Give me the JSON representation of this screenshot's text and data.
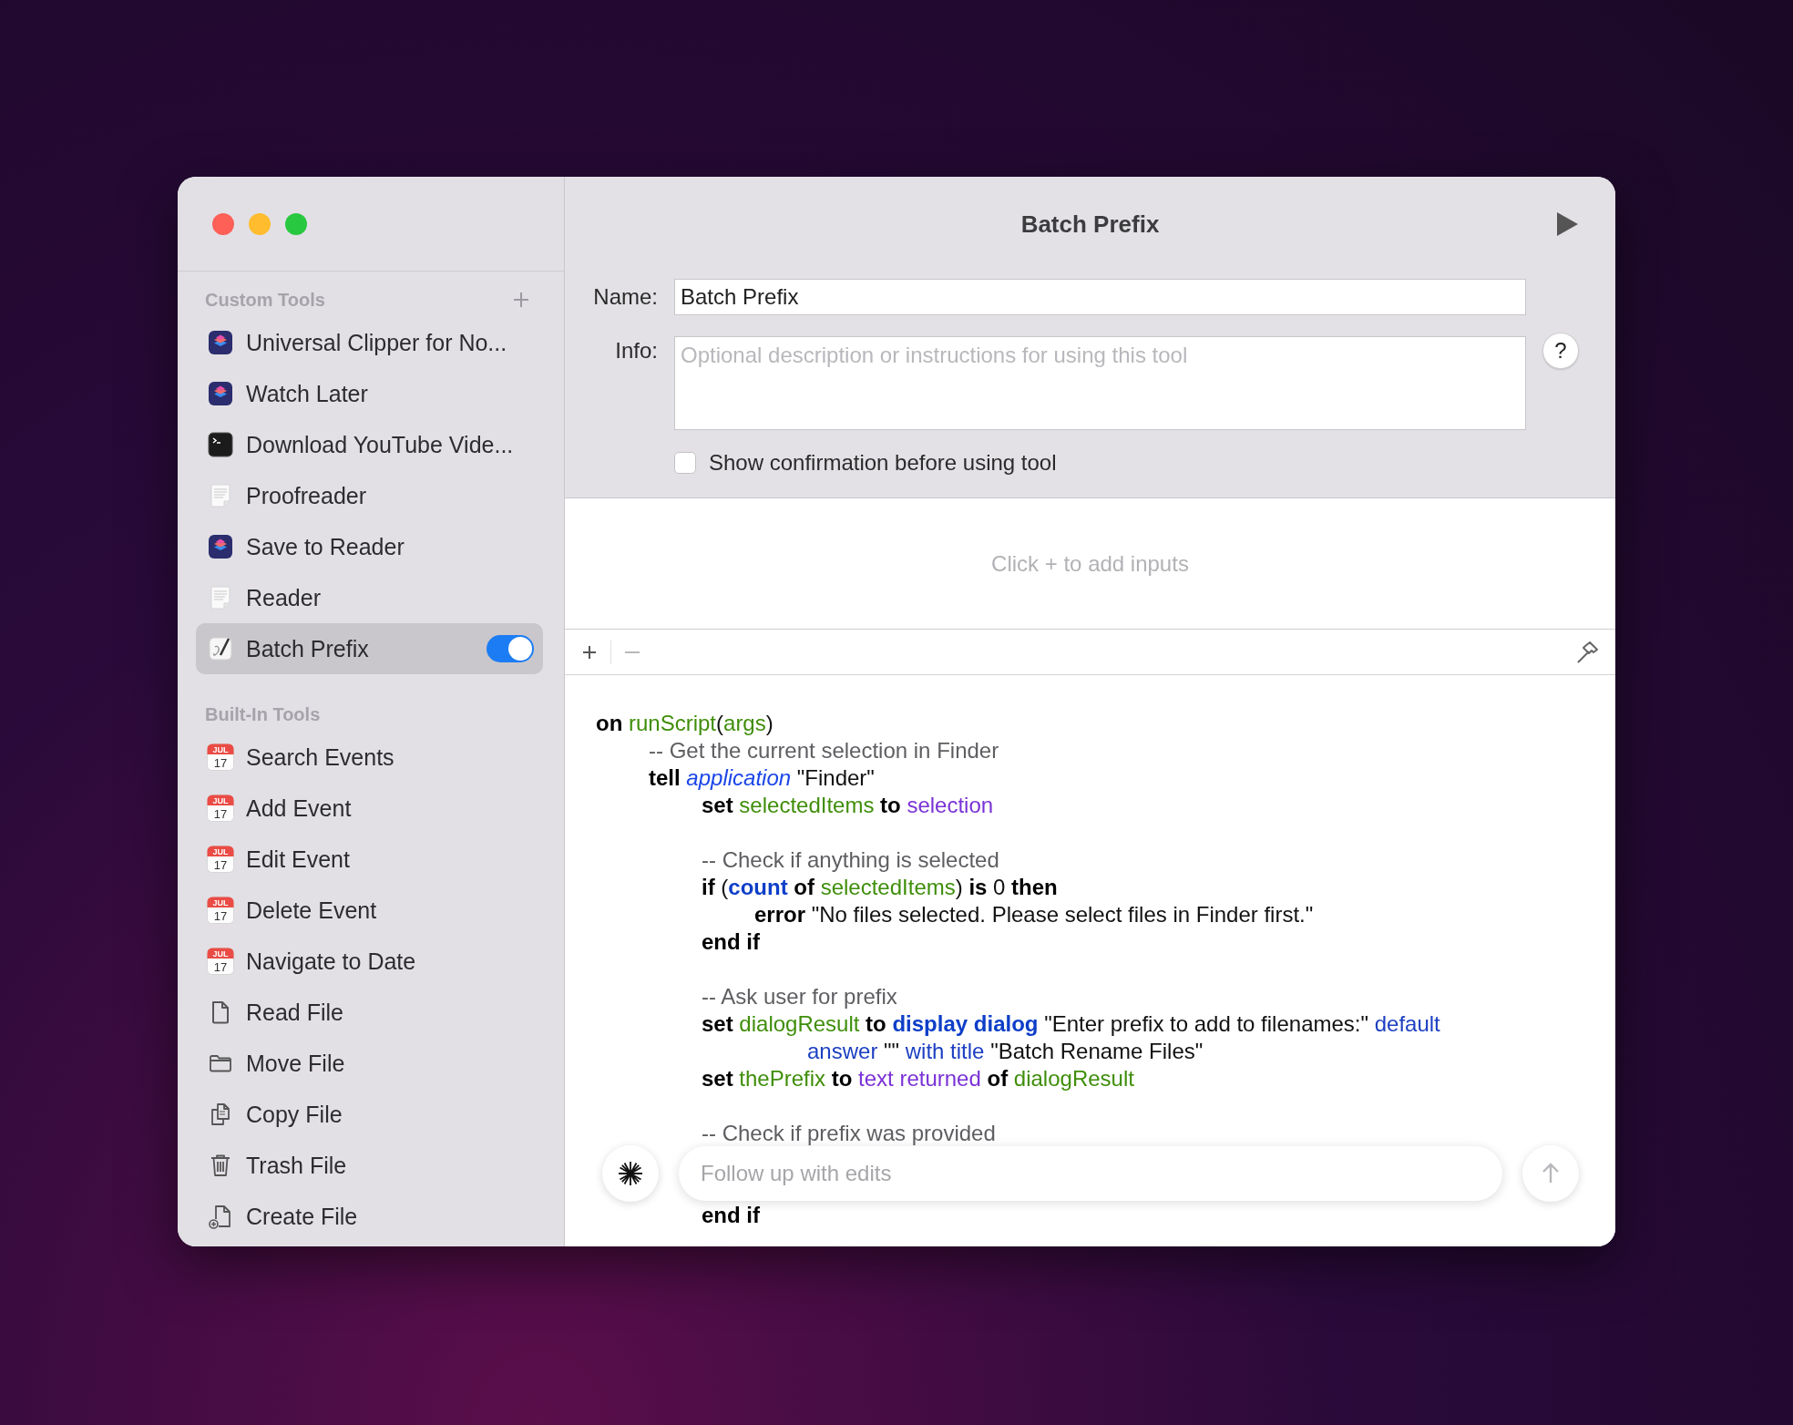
{
  "window": {
    "title": "Batch Prefix"
  },
  "sidebar": {
    "sections": [
      {
        "title": "Custom Tools",
        "add_button": true,
        "items": [
          {
            "label": "Universal Clipper for No...",
            "kind": "shortcuts",
            "selected": false
          },
          {
            "label": "Watch Later",
            "kind": "shortcuts",
            "selected": false
          },
          {
            "label": "Download YouTube Vide...",
            "kind": "terminal",
            "selected": false
          },
          {
            "label": "Proofreader",
            "kind": "document",
            "selected": false
          },
          {
            "label": "Save to Reader",
            "kind": "shortcuts",
            "selected": false
          },
          {
            "label": "Reader",
            "kind": "document",
            "selected": false
          },
          {
            "label": "Batch Prefix",
            "kind": "script",
            "selected": true,
            "toggle_on": true
          }
        ]
      },
      {
        "title": "Built-In Tools",
        "add_button": false,
        "items": [
          {
            "label": "Search Events",
            "kind": "calendar",
            "icon_month": "JUL",
            "icon_day": "17",
            "selected": false
          },
          {
            "label": "Add Event",
            "kind": "calendar",
            "icon_month": "JUL",
            "icon_day": "17",
            "selected": false
          },
          {
            "label": "Edit Event",
            "kind": "calendar",
            "icon_month": "JUL",
            "icon_day": "17",
            "selected": false
          },
          {
            "label": "Delete Event",
            "kind": "calendar",
            "icon_month": "JUL",
            "icon_day": "17",
            "selected": false
          },
          {
            "label": "Navigate to Date",
            "kind": "calendar",
            "icon_month": "JUL",
            "icon_day": "17",
            "selected": false
          },
          {
            "label": "Read File",
            "kind": "file",
            "selected": false
          },
          {
            "label": "Move File",
            "kind": "folder",
            "selected": false
          },
          {
            "label": "Copy File",
            "kind": "copy",
            "selected": false
          },
          {
            "label": "Trash File",
            "kind": "trash",
            "selected": false
          },
          {
            "label": "Create File",
            "kind": "file-add",
            "selected": false
          }
        ]
      }
    ]
  },
  "form": {
    "name_label": "Name:",
    "name_value": "Batch Prefix",
    "info_label": "Info:",
    "info_placeholder": "Optional description or instructions for using this tool",
    "help_button": "?",
    "confirm": {
      "label": "Show confirmation before using tool",
      "checked": false
    }
  },
  "inputs": {
    "empty_hint": "Click + to add inputs"
  },
  "code": {
    "blocks": [
      [
        [
          {
            "kind": "keyword",
            "text": "on"
          },
          {
            "kind": "var",
            "text": " runScript"
          },
          {
            "kind": "plain",
            "text": "("
          },
          {
            "kind": "var",
            "text": "args"
          },
          {
            "kind": "plain",
            "text": ")"
          }
        ],
        [
          {
            "kind": "comment",
            "text": "\t-- Get the current selection in Finder"
          }
        ],
        [
          {
            "kind": "keyword",
            "text": "\ttell"
          },
          {
            "kind": "class",
            "text": " application"
          },
          {
            "kind": "plain",
            "text": " \"Finder\""
          }
        ],
        [
          {
            "kind": "keyword",
            "text": "\t\tset"
          },
          {
            "kind": "var",
            "text": " selectedItems"
          },
          {
            "kind": "keyword",
            "text": " to"
          },
          {
            "kind": "prop",
            "text": " selection"
          }
        ]
      ],
      [
        [
          {
            "kind": "comment",
            "text": "\t\t-- Check if anything is selected"
          }
        ],
        [
          {
            "kind": "keyword",
            "text": "\t\tif"
          },
          {
            "kind": "plain",
            "text": " ("
          },
          {
            "kind": "command",
            "text": "count"
          },
          {
            "kind": "keyword",
            "text": " of"
          },
          {
            "kind": "var",
            "text": " selectedItems"
          },
          {
            "kind": "plain",
            "text": ")"
          },
          {
            "kind": "keyword",
            "text": " is"
          },
          {
            "kind": "plain",
            "text": " 0"
          },
          {
            "kind": "keyword",
            "text": " then"
          }
        ],
        [
          {
            "kind": "keyword",
            "text": "\t\t\terror"
          },
          {
            "kind": "plain",
            "text": " \"No files selected. Please select files in Finder first.\""
          }
        ],
        [
          {
            "kind": "keyword",
            "text": "\t\tend if"
          }
        ]
      ],
      [
        [
          {
            "kind": "comment",
            "text": "\t\t-- Ask user for prefix"
          }
        ],
        [
          {
            "kind": "keyword",
            "text": "\t\tset"
          },
          {
            "kind": "var",
            "text": " dialogResult"
          },
          {
            "kind": "keyword",
            "text": " to"
          },
          {
            "kind": "command",
            "text": " display dialog"
          },
          {
            "kind": "plain",
            "text": " \"Enter prefix to add to filenames:\""
          },
          {
            "kind": "param",
            "text": " default"
          }
        ],
        [
          {
            "kind": "param",
            "text": "\t\t\t\tanswer"
          },
          {
            "kind": "plain",
            "text": " \"\""
          },
          {
            "kind": "param",
            "text": " with title"
          },
          {
            "kind": "plain",
            "text": " \"Batch Rename Files\""
          }
        ],
        [
          {
            "kind": "keyword",
            "text": "\t\tset"
          },
          {
            "kind": "var",
            "text": " thePrefix"
          },
          {
            "kind": "keyword",
            "text": " to"
          },
          {
            "kind": "prop",
            "text": " text returned"
          },
          {
            "kind": "keyword",
            "text": " of"
          },
          {
            "kind": "var",
            "text": " dialogResult"
          }
        ]
      ],
      [
        [
          {
            "kind": "comment",
            "text": "\t\t-- Check if prefix was provided"
          }
        ]
      ]
    ],
    "below_bar": [
      [
        {
          "kind": "keyword",
          "text": "\t\tend if"
        }
      ]
    ]
  },
  "chat": {
    "placeholder": "Follow up with edits"
  }
}
